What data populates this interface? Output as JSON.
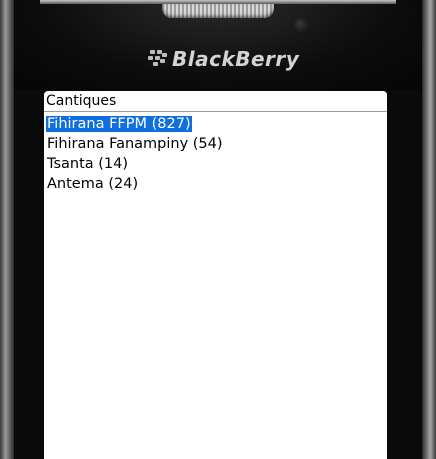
{
  "device": {
    "brand_logo": "BlackBerry",
    "logo_icon": "blackberry-logo-icon"
  },
  "screen": {
    "title": "Cantiques",
    "items": [
      {
        "label": "Fihirana FFPM (827)",
        "selected": true
      },
      {
        "label": "Fihirana Fanampiny (54)",
        "selected": false
      },
      {
        "label": "Tsanta (14)",
        "selected": false
      },
      {
        "label": "Antema (24)",
        "selected": false
      }
    ]
  },
  "colors": {
    "selection": "#0f6fde",
    "bezel": "#0a0a0a",
    "screen_bg": "#ffffff"
  }
}
